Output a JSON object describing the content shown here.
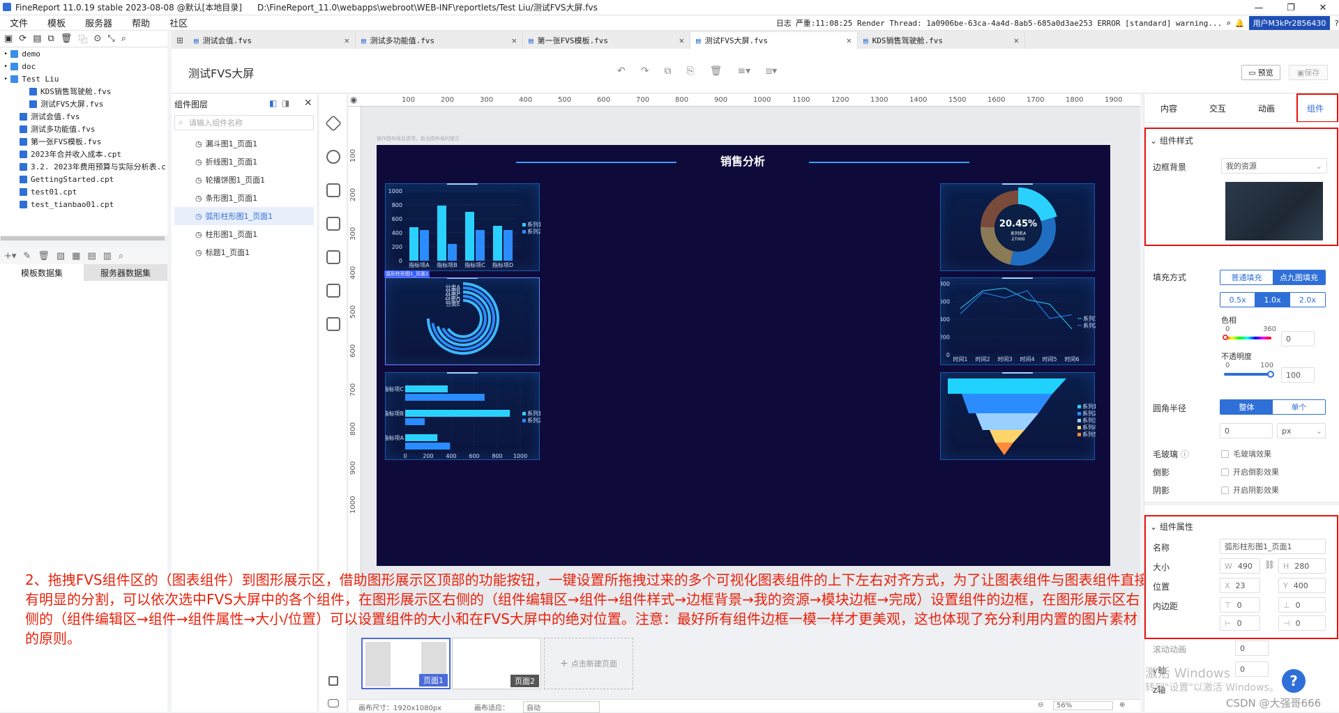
{
  "window": {
    "title": "FineReport 11.0.19 stable 2023-08-08 @默认[本地目录]",
    "path": "D:\\FineReport_11.0\\webapps\\webroot\\WEB-INF\\reportlets/Test Liu/测试FVS大屏.fvs"
  },
  "menu": [
    "文件",
    "模板",
    "服务器",
    "帮助",
    "社区"
  ],
  "status": {
    "log": "日志",
    "error": "严重:11:08:25 Render Thread: 1a0906be-63ca-4a4d-8ab5-685a0d3ae253 ERROR [standard] warning...",
    "user": "用户M3kPr2856430"
  },
  "tree": [
    {
      "label": "demo",
      "type": "folder",
      "indent": 0
    },
    {
      "label": "doc",
      "type": "folder",
      "indent": 0
    },
    {
      "label": "Test Liu",
      "type": "folder",
      "indent": 0
    },
    {
      "label": "KDS销售驾驶舱.fvs",
      "type": "fvs",
      "indent": 2
    },
    {
      "label": "测试FVS大屏.fvs",
      "type": "fvs",
      "indent": 2
    },
    {
      "label": "测试会值.fvs",
      "type": "fvs",
      "indent": 1
    },
    {
      "label": "测试多功能值.fvs",
      "type": "fvs",
      "indent": 1
    },
    {
      "label": "第一张FVS模板.fvs",
      "type": "fvs",
      "indent": 1
    },
    {
      "label": "2023年合并收入成本.cpt",
      "type": "cpt",
      "indent": 1
    },
    {
      "label": "3.2. 2023年费用预算与实际分析表.c",
      "type": "cpt",
      "indent": 1
    },
    {
      "label": "GettingStarted.cpt",
      "type": "cpt",
      "indent": 1
    },
    {
      "label": "test01.cpt",
      "type": "cpt",
      "indent": 1
    },
    {
      "label": "test_tianbao01.cpt",
      "type": "cpt",
      "indent": 1
    }
  ],
  "dataset_tabs": [
    "模板数据集",
    "服务器数据集"
  ],
  "tabs": [
    {
      "label": "测试会值.fvs",
      "active": false
    },
    {
      "label": "测试多功能值.fvs",
      "active": false
    },
    {
      "label": "第一张FVS模板.fvs",
      "active": false
    },
    {
      "label": "测试FVS大屏.fvs",
      "active": true
    },
    {
      "label": "KDS销售驾驶舱.fvs",
      "active": false
    }
  ],
  "doc": {
    "title": "测试FVS大屏",
    "preview": "预览",
    "save": "保存"
  },
  "layers": {
    "title": "组件图层",
    "search_placeholder": "请输入组件名称",
    "items": [
      {
        "label": "漏斗图1_页面1",
        "selected": false
      },
      {
        "label": "折线图1_页面1",
        "selected": false
      },
      {
        "label": "轮播饼图1_页面1",
        "selected": false
      },
      {
        "label": "条形图1_页面1",
        "selected": false
      },
      {
        "label": "弧形柱形图1_页面1",
        "selected": true
      },
      {
        "label": "柱形图1_页面1",
        "selected": false
      },
      {
        "label": "标题1_页面1",
        "selected": false
      }
    ]
  },
  "ruler": {
    "top": [
      "100",
      "200",
      "300",
      "400",
      "500",
      "600",
      "700",
      "800",
      "900",
      "1000",
      "1100",
      "1200",
      "1300",
      "1400",
      "1500",
      "1600",
      "1700",
      "1800",
      "1900"
    ],
    "left": [
      "100",
      "200",
      "300",
      "400",
      "500",
      "600",
      "700",
      "800",
      "900",
      "1000"
    ]
  },
  "canvas": {
    "hint": "操作图布局及选项，新出图布局的提示",
    "screen_title": "销售分析",
    "selected_tag": "弧形柱形图1_页面1"
  },
  "charts": {
    "bar": {
      "type": "bar",
      "categories": [
        "指标项A",
        "指标项B",
        "指标项C",
        "指标项D"
      ],
      "series": [
        {
          "name": "系列1",
          "values": [
            480,
            790,
            700,
            500
          ]
        },
        {
          "name": "系列2",
          "values": [
            440,
            240,
            440,
            440
          ]
        }
      ],
      "yticks": [
        "0",
        "200",
        "400",
        "600",
        "800",
        "1000"
      ],
      "ylim": [
        0,
        1000
      ]
    },
    "radial": {
      "type": "bar",
      "categories": [
        "分类A",
        "分类B",
        "分类C",
        "分类D",
        "分类E"
      ]
    },
    "hbar": {
      "type": "bar",
      "categories": [
        "指标项A",
        "指标项B",
        "指标项C"
      ],
      "series": [
        {
          "name": "系列1",
          "values": [
            280,
            910,
            370
          ]
        },
        {
          "name": "系列2",
          "values": [
            390,
            170,
            690
          ]
        }
      ],
      "xticks": [
        "0",
        "200",
        "400",
        "600",
        "800",
        "1000"
      ],
      "xlim": [
        0,
        1000
      ]
    },
    "pie": {
      "type": "pie",
      "center_value": "20.45%",
      "center_label": "系列名A",
      "center_sub": "27000"
    },
    "line": {
      "type": "line",
      "categories": [
        "时间1",
        "时间2",
        "时间3",
        "时间4",
        "时间5",
        "时间6"
      ],
      "series": [
        {
          "name": "系列1",
          "values": [
            520,
            720,
            750,
            620,
            570,
            290
          ]
        },
        {
          "name": "系列2",
          "values": [
            460,
            700,
            640,
            720,
            410,
            450
          ]
        }
      ],
      "yticks": [
        "0",
        "200",
        "400",
        "600",
        "800"
      ],
      "ylim": [
        0,
        800
      ]
    },
    "funnel": {
      "type": "bar",
      "legend": [
        "系列1",
        "系列2",
        "系列3",
        "系列4",
        "系列5"
      ]
    }
  },
  "annotation": "2、拖拽FVS组件区的（图表组件）到图形展示区，借助图形展示区顶部的功能按钮，一键设置所拖拽过来的多个可视化图表组件的上下左右对齐方式，为了让图表组件与图表组件直接有明显的分割，可以依次选中FVS大屏中的各个组件，在图形展示区右侧的（组件编辑区→组件→组件样式→边框背景→我的资源→模块边框→完成）设置组件的边框，在图形展示区右侧的（组件编辑区→组件→组件属性→大小/位置）可以设置组件的大小和在FVS大屏中的绝对位置。注意：最好所有组件边框一模一样才更美观，这也体现了充分利用内置的图片素材的原则。",
  "pages": {
    "p1": "页面1",
    "p2": "页面2",
    "add": "点击新建页面"
  },
  "bottom": {
    "size": "画布尺寸：1920x1080px",
    "adapt": "画布适应：",
    "adapt_val": "自动",
    "zoom": "56%"
  },
  "right": {
    "tabs": [
      "内容",
      "交互",
      "动画",
      "组件"
    ],
    "style_section": "组件样式",
    "border_bg_label": "边框背景",
    "border_bg_value": "我的资源",
    "fill_label": "填充方式",
    "fill_opts": [
      "普通填充",
      "点九图填充"
    ],
    "scale_opts": [
      "0.5x",
      "1.0x",
      "2.0x"
    ],
    "hue_label": "色相",
    "hue_min": "0",
    "hue_max": "360",
    "hue_val": "0",
    "opacity_label": "不透明度",
    "op_min": "0",
    "op_max": "100",
    "op_val": "100",
    "radius_label": "圆角半径",
    "radius_opts": [
      "整体",
      "单个"
    ],
    "radius_val": "0",
    "radius_unit": "px",
    "blur_label": "毛玻璃",
    "blur_chk": "毛玻璃效果",
    "reflect_label": "倒影",
    "reflect_chk": "开启倒影效果",
    "shadow_label": "阴影",
    "shadow_chk": "开启阴影效果",
    "prop_section": "组件属性",
    "name_label": "名称",
    "name_val": "弧形柱形图1_页面1",
    "size_label": "大小",
    "w": "490",
    "h": "280",
    "pos_label": "位置",
    "x": "23",
    "y": "400",
    "pad_label": "内边距",
    "pad": [
      "0",
      "0",
      "0",
      "0"
    ],
    "anim_label": "滚动动画",
    "anim_val": "0",
    "y_label": "y轴",
    "y_val": "0",
    "z_label": "z轴"
  },
  "watermark": {
    "win1": "激活 Windows",
    "win2": "转到\"设置\"以激活 Windows。",
    "csdn": "CSDN @大强哥666"
  }
}
